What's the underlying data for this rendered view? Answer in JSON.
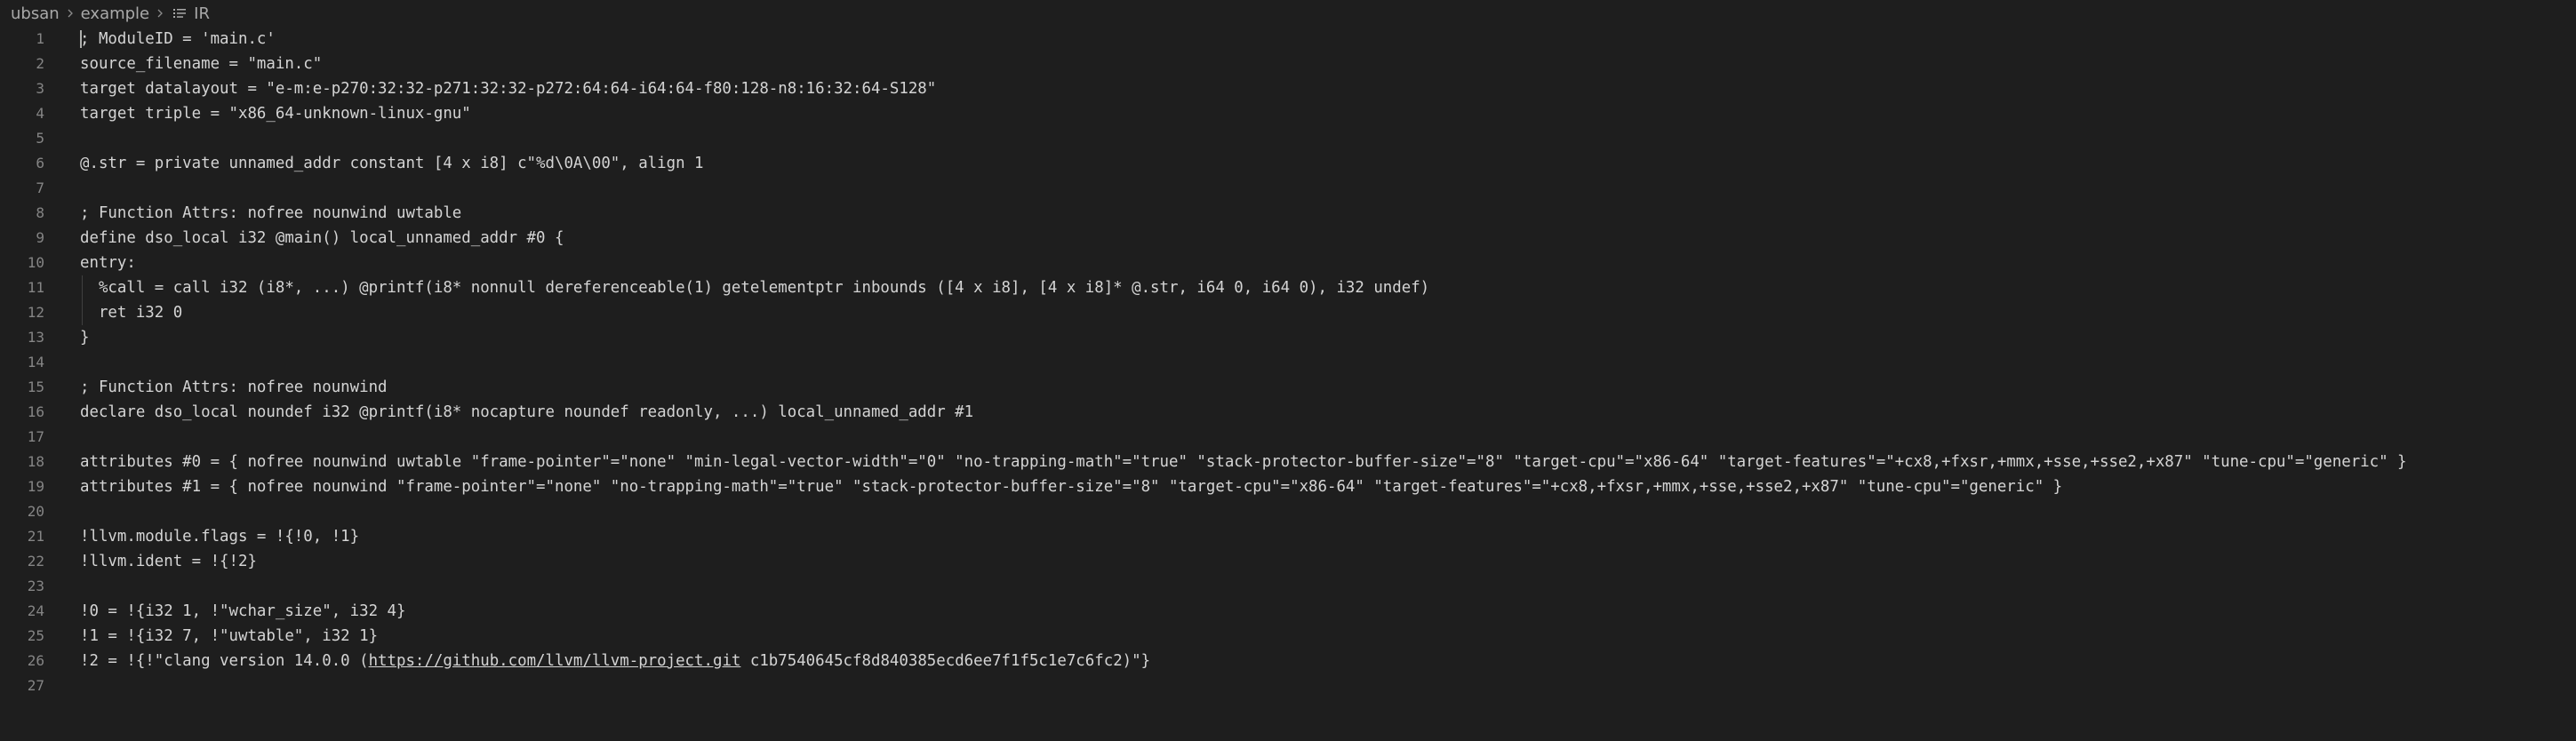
{
  "breadcrumb": {
    "items": [
      "ubsan",
      "example",
      "IR"
    ]
  },
  "editor": {
    "lines": [
      "; ModuleID = 'main.c'",
      "source_filename = \"main.c\"",
      "target datalayout = \"e-m:e-p270:32:32-p271:32:32-p272:64:64-i64:64-f80:128-n8:16:32:64-S128\"",
      "target triple = \"x86_64-unknown-linux-gnu\"",
      "",
      "@.str = private unnamed_addr constant [4 x i8] c\"%d\\0A\\00\", align 1",
      "",
      "; Function Attrs: nofree nounwind uwtable",
      "define dso_local i32 @main() local_unnamed_addr #0 {",
      "entry:",
      "  %call = call i32 (i8*, ...) @printf(i8* nonnull dereferenceable(1) getelementptr inbounds ([4 x i8], [4 x i8]* @.str, i64 0, i64 0), i32 undef)",
      "  ret i32 0",
      "}",
      "",
      "; Function Attrs: nofree nounwind",
      "declare dso_local noundef i32 @printf(i8* nocapture noundef readonly, ...) local_unnamed_addr #1",
      "",
      "attributes #0 = { nofree nounwind uwtable \"frame-pointer\"=\"none\" \"min-legal-vector-width\"=\"0\" \"no-trapping-math\"=\"true\" \"stack-protector-buffer-size\"=\"8\" \"target-cpu\"=\"x86-64\" \"target-features\"=\"+cx8,+fxsr,+mmx,+sse,+sse2,+x87\" \"tune-cpu\"=\"generic\" }",
      "attributes #1 = { nofree nounwind \"frame-pointer\"=\"none\" \"no-trapping-math\"=\"true\" \"stack-protector-buffer-size\"=\"8\" \"target-cpu\"=\"x86-64\" \"target-features\"=\"+cx8,+fxsr,+mmx,+sse,+sse2,+x87\" \"tune-cpu\"=\"generic\" }",
      "",
      "!llvm.module.flags = !{!0, !1}",
      "!llvm.ident = !{!2}",
      "",
      "!0 = !{i32 1, !\"wchar_size\", i32 4}",
      "!1 = !{i32 7, !\"uwtable\", i32 1}",
      "!2 = !{!\"clang version 14.0.0 (https://github.com/llvm/llvm-project.git c1b7540645cf8d840385ecd6ee7f1f5c1e7c6fc2)\"}",
      ""
    ],
    "line_numbers": [
      "1",
      "2",
      "3",
      "4",
      "5",
      "6",
      "7",
      "8",
      "9",
      "10",
      "11",
      "12",
      "13",
      "14",
      "15",
      "16",
      "17",
      "18",
      "19",
      "20",
      "21",
      "22",
      "23",
      "24",
      "25",
      "26",
      "27"
    ],
    "link_text": "https://github.com/llvm/llvm-project.git"
  },
  "colors": {
    "background": "#1e1e1e",
    "text": "#d4d4d4",
    "line_number": "#858585",
    "breadcrumb": "#a9a9a9"
  },
  "icons": {
    "breadcrumb_separator": "chevron-right-icon",
    "file_type": "list-icon"
  }
}
